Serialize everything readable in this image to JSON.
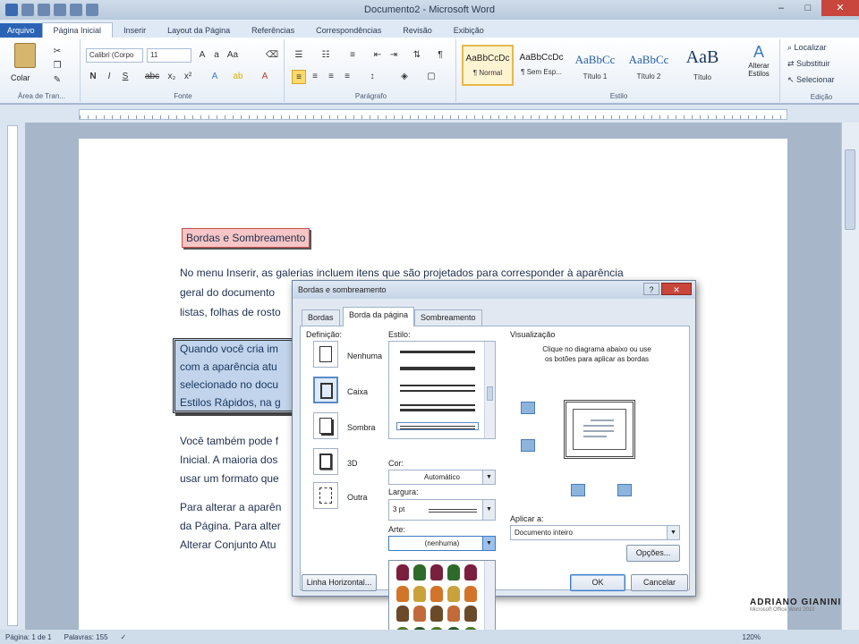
{
  "window": {
    "title": "Documento2 - Microsoft Word"
  },
  "tabs": [
    "Arquivo",
    "Página Inicial",
    "Inserir",
    "Layout da Página",
    "Referências",
    "Correspondências",
    "Revisão",
    "Exibição"
  ],
  "ribbon": {
    "clipboard": {
      "paste_label": "Colar",
      "group_label": "Área de Tran..."
    },
    "font": {
      "font_name": "Calibri (Corpo",
      "font_size": "11",
      "group_label": "Fonte"
    },
    "paragraph": {
      "group_label": "Parágrafo"
    },
    "styles": {
      "items": [
        {
          "sample": "AaBbCcDc",
          "name": "¶ Normal"
        },
        {
          "sample": "AaBbCcDc",
          "name": "¶ Sem Esp..."
        },
        {
          "sample": "AaBbCc",
          "name": "Título 1"
        },
        {
          "sample": "AaBbCc",
          "name": "Título 2"
        },
        {
          "sample": "AaB",
          "name": "Título"
        }
      ],
      "change_label": "Alterar Estilos",
      "group_label": "Estilo"
    },
    "editing": {
      "find": "Localizar",
      "replace": "Substituir",
      "select": "Selecionar",
      "group_label": "Edição"
    }
  },
  "document": {
    "heading": "Bordas e Sombreamento",
    "p1": [
      "No menu Inserir, as galerias incluem itens que são projetados para corresponder à aparência",
      "geral do documento",
      "listas, folhas de rosto"
    ],
    "shaded": [
      "Quando você cria im",
      "com a aparência atu",
      "selecionado no docu",
      "Estilos Rápidos, na g"
    ],
    "p2": [
      "Você também pode f",
      "Inicial. A maioria dos",
      "usar um formato que"
    ],
    "p3": [
      "Para alterar a aparên",
      "da Página. Para alter",
      "Alterar Conjunto Atu"
    ]
  },
  "dialog": {
    "title": "Bordas e sombreamento",
    "tabs": [
      "Bordas",
      "Borda da página",
      "Sombreamento"
    ],
    "definition_label": "Definição:",
    "settings": [
      "Nenhuma",
      "Caixa",
      "Sombra",
      "3D",
      "Outra"
    ],
    "style_label": "Estilo:",
    "color_label": "Cor:",
    "color_value": "Automático",
    "width_label": "Largura:",
    "width_value": "3 pt",
    "art_label": "Arte:",
    "art_value": "(nenhuma)",
    "preview_label": "Visualização",
    "preview_hint": "Clique no diagrama abaixo ou use os botões para aplicar as bordas",
    "apply_label": "Aplicar a:",
    "apply_value": "Documento inteiro",
    "options_button": "Opções...",
    "horizontal_line_button": "Linha Horizontal...",
    "ok_button": "OK",
    "cancel_button": "Cancelar"
  },
  "status": {
    "page": "Página: 1 de 1",
    "words": "Palavras: 155",
    "zoom": "120%"
  },
  "watermark": {
    "brand": "ADRIANO GIANINI",
    "sub": "Microsoft Office Word 2010"
  }
}
